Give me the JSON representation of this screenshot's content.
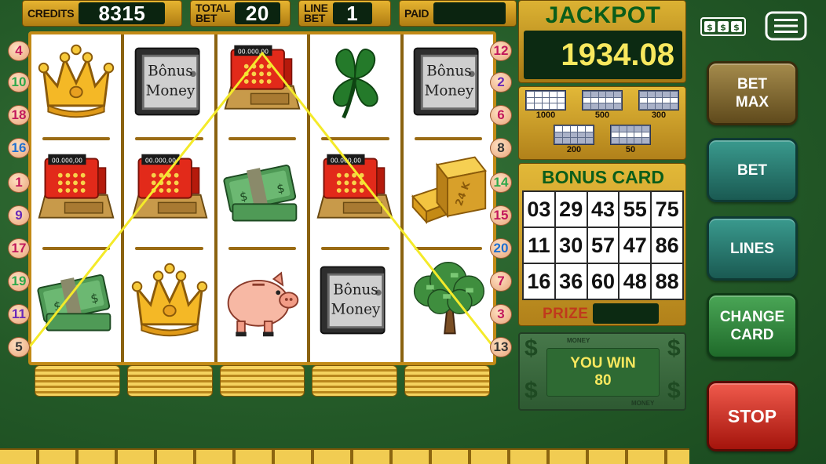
{
  "top_bar": {
    "credits_label": "CREDITS",
    "credits_value": "8315",
    "total_bet_label_1": "TOTAL",
    "total_bet_label_2": "BET",
    "total_bet_value": "20",
    "line_bet_label_1": "LINE",
    "line_bet_label_2": "BET",
    "line_bet_value": "1",
    "paid_label": "PAID",
    "paid_value": ""
  },
  "reels": [
    [
      "crown",
      "cash-register",
      "money-stack"
    ],
    [
      "bonus-safe",
      "cash-register",
      "crown"
    ],
    [
      "cash-register",
      "money-stack",
      "piggy-bank"
    ],
    [
      "clover",
      "cash-register",
      "bonus-safe"
    ],
    [
      "bonus-safe",
      "gold-bars",
      "money-tree"
    ]
  ],
  "symbol_text": {
    "safe_line_1": "Bônus",
    "safe_line_2": "Money",
    "register_display": "00.000,00",
    "gold_bar": "24 K"
  },
  "paylines": {
    "left": [
      "4",
      "10",
      "18",
      "16",
      "1",
      "9",
      "17",
      "19",
      "11",
      "5"
    ],
    "right": [
      "12",
      "2",
      "6",
      "8",
      "14",
      "15",
      "20",
      "7",
      "3",
      "13"
    ]
  },
  "jackpot": {
    "label": "JACKPOT",
    "value": "1934.08"
  },
  "paytable": {
    "pattern_1": "1000",
    "pattern_2": "500",
    "pattern_3": "300",
    "pattern_4": "200",
    "pattern_5": "50"
  },
  "bonus_card": {
    "title": "BONUS CARD",
    "numbers": [
      "03",
      "29",
      "43",
      "55",
      "75",
      "11",
      "30",
      "57",
      "47",
      "86",
      "16",
      "36",
      "60",
      "48",
      "88"
    ],
    "prize_label": "PRIZE",
    "prize_value": ""
  },
  "win": {
    "label": "YOU WIN",
    "amount": "80",
    "money_tag": "MONEY"
  },
  "buttons": {
    "bet_max_1": "BET",
    "bet_max_2": "MAX",
    "bet": "BET",
    "lines": "LINES",
    "change_card_1": "CHANGE",
    "change_card_2": "CARD",
    "stop": "STOP"
  },
  "colors": {
    "felt": "#2d6a32",
    "gold": "#d8a928",
    "jackpot_text": "#f8e85e",
    "payline": "#f4ea2a",
    "stop_button": "#d1281c"
  },
  "line_number_colors": {
    "4": "#c2185b",
    "10": "#2ea84a",
    "18": "#c2185b",
    "16": "#1e6fd0",
    "1": "#c2185b",
    "9": "#6a2ab8",
    "17": "#c2185b",
    "19": "#2ea84a",
    "11": "#6a2ab8",
    "5": "#333333",
    "12": "#c2185b",
    "2": "#6a2ab8",
    "6": "#c2185b",
    "8": "#333333",
    "14": "#2ea84a",
    "15": "#c2185b",
    "20": "#1e6fd0",
    "7": "#c2185b",
    "3": "#c2185b",
    "13": "#333333"
  }
}
